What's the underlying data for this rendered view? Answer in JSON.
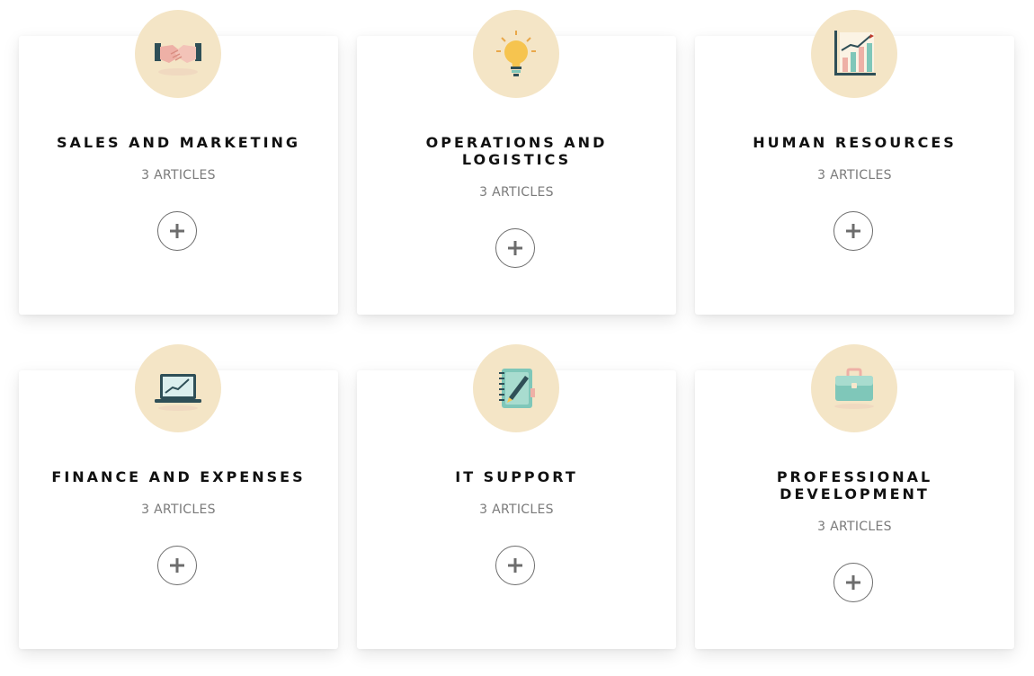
{
  "categories": [
    {
      "title": "SALES AND MARKETING",
      "count": "3 ARTICLES",
      "icon": "handshake-icon"
    },
    {
      "title": "OPERATIONS AND LOGISTICS",
      "count": "3 ARTICLES",
      "icon": "lightbulb-icon"
    },
    {
      "title": "HUMAN RESOURCES",
      "count": "3 ARTICLES",
      "icon": "growth-chart-icon"
    },
    {
      "title": "FINANCE AND EXPENSES",
      "count": "3 ARTICLES",
      "icon": "laptop-chart-icon"
    },
    {
      "title": "IT SUPPORT",
      "count": "3 ARTICLES",
      "icon": "notebook-pen-icon"
    },
    {
      "title": "PROFESSIONAL DEVELOPMENT",
      "count": "3 ARTICLES",
      "icon": "briefcase-icon"
    }
  ],
  "colors": {
    "icon_circle": "#f4e5c6",
    "title_text": "#111111",
    "count_text": "#7a7a7a",
    "button_border": "#6d6d6d",
    "accent_teal": "#7fc7b9",
    "accent_pink": "#eeb0a6",
    "accent_dark": "#2f4f57"
  }
}
